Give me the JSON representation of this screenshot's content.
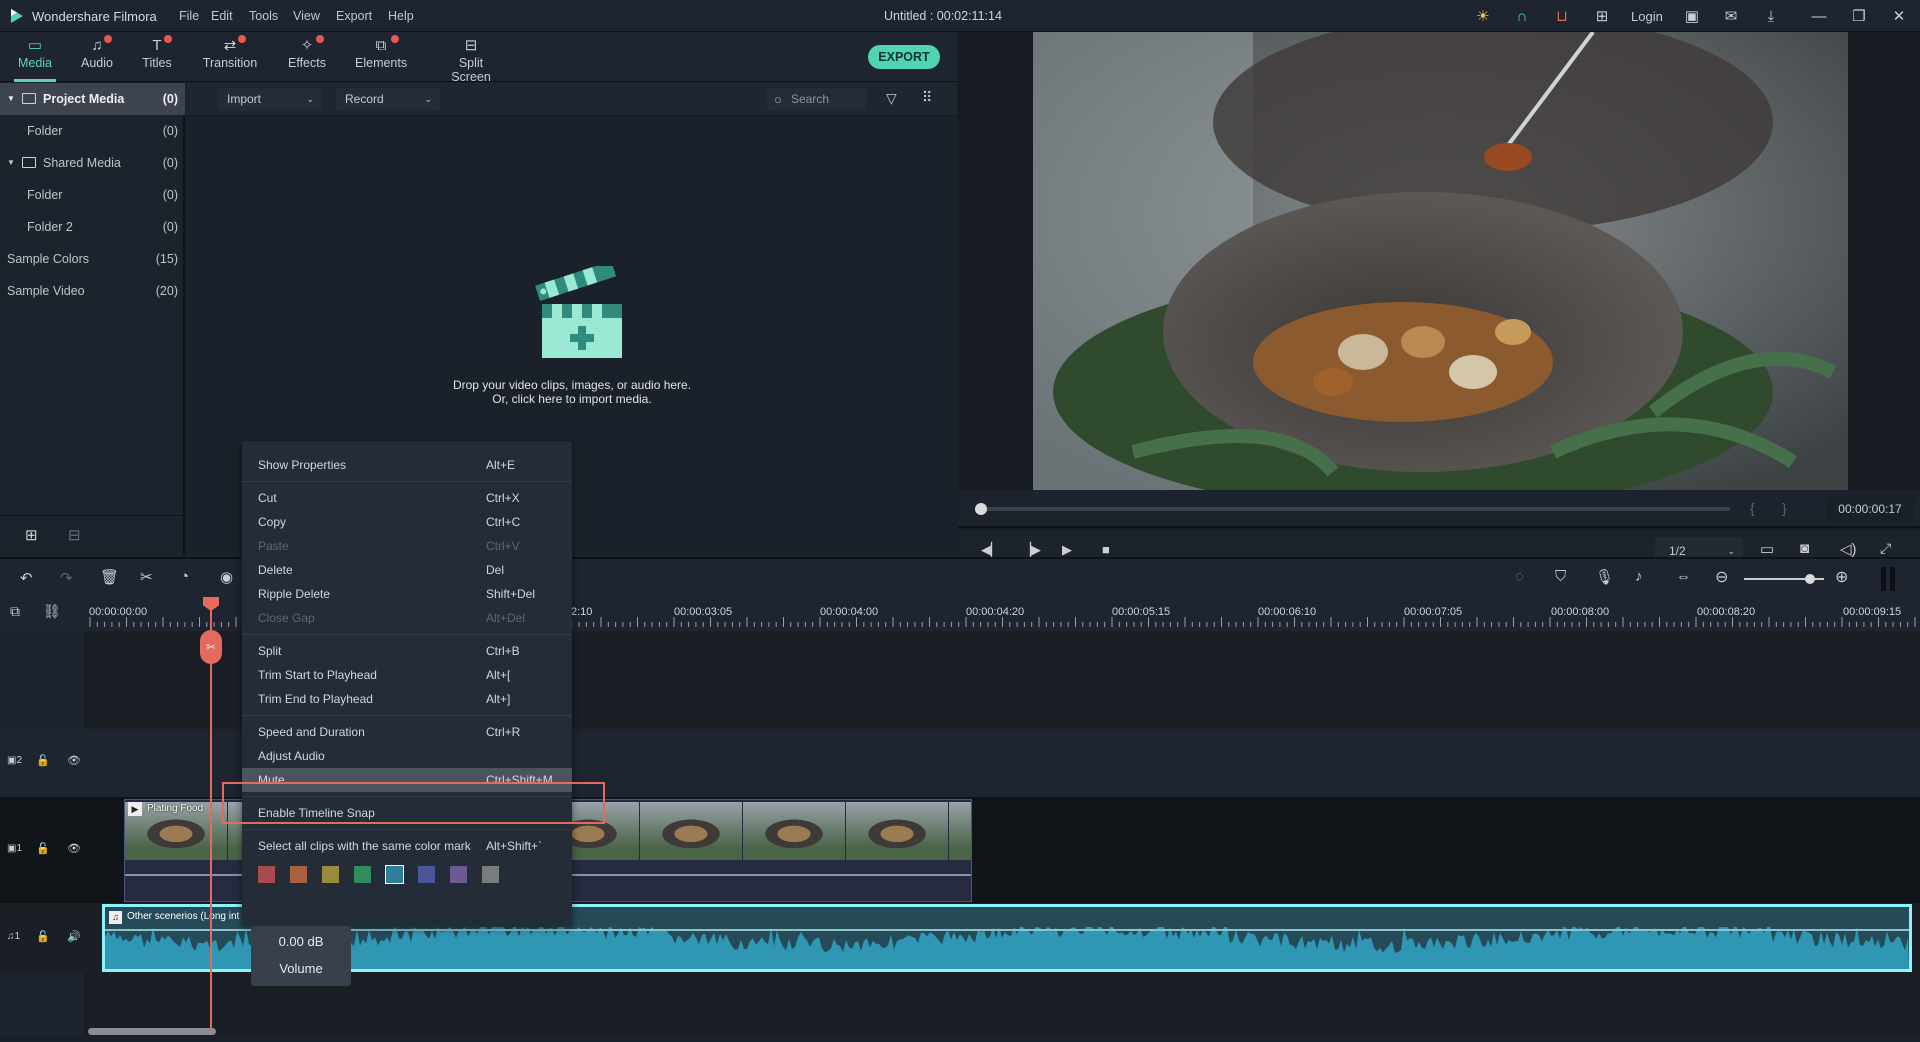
{
  "app": {
    "name": "Wondershare Filmora",
    "title": "Untitled : 00:02:11:14",
    "login_label": "Login"
  },
  "menu": [
    "File",
    "Edit",
    "Tools",
    "View",
    "Export",
    "Help"
  ],
  "tabs": [
    {
      "label": "Media",
      "icon": "folder-icon",
      "active": true,
      "dot": false
    },
    {
      "label": "Audio",
      "icon": "music-note-icon",
      "active": false,
      "dot": true
    },
    {
      "label": "Titles",
      "icon": "text-icon",
      "active": false,
      "dot": true
    },
    {
      "label": "Transition",
      "icon": "transition-icon",
      "active": false,
      "dot": true
    },
    {
      "label": "Effects",
      "icon": "effects-icon",
      "active": false,
      "dot": true
    },
    {
      "label": "Elements",
      "icon": "elements-icon",
      "active": false,
      "dot": true
    },
    {
      "label": "Split Screen",
      "icon": "split-screen-icon",
      "active": false,
      "dot": false
    }
  ],
  "export_label": "EXPORT",
  "sidebar": [
    {
      "label": "Project Media",
      "count": "(0)",
      "selected": true,
      "folder": true
    },
    {
      "label": "Folder",
      "count": "(0)",
      "indent": true
    },
    {
      "label": "Shared Media",
      "count": "(0)",
      "folder": true
    },
    {
      "label": "Folder",
      "count": "(0)",
      "indent": true
    },
    {
      "label": "Folder 2",
      "count": "(0)",
      "indent": true
    },
    {
      "label": "Sample Colors",
      "count": "(15)"
    },
    {
      "label": "Sample Video",
      "count": "(20)"
    }
  ],
  "media": {
    "import_label": "Import",
    "record_label": "Record",
    "search_placeholder": "Search",
    "empty_line1": "Drop your video clips, images, or audio here.",
    "empty_line2": "Or, click here to import media."
  },
  "preview": {
    "timecode": "00:00:00:17",
    "zoom": "1/2",
    "progress": 0.0
  },
  "timeline": {
    "ruler": [
      "00:00:00:00",
      "00:00:03:05",
      "00:00:04:00",
      "00:00:04:20",
      "00:00:05:15",
      "00:00:06:10",
      "00:00:07:05",
      "00:00:08:00",
      "00:00:08:20",
      "00:00:09:15"
    ],
    "ruler_partial": "2:10",
    "zoom_level": 0.82,
    "tracks": [
      {
        "id": "V2",
        "num": "2",
        "kind": "video"
      },
      {
        "id": "V1",
        "num": "1",
        "kind": "video"
      },
      {
        "id": "A1",
        "num": "1",
        "kind": "audio"
      }
    ],
    "video_clip": "Plating Food",
    "audio_clip": "Other scenerios  (Long int"
  },
  "context_menu": {
    "items": [
      {
        "label": "Show Properties",
        "key": "Alt+E"
      },
      {
        "sep": true
      },
      {
        "label": "Cut",
        "key": "Ctrl+X"
      },
      {
        "label": "Copy",
        "key": "Ctrl+C"
      },
      {
        "label": "Paste",
        "key": "Ctrl+V",
        "disabled": true
      },
      {
        "label": "Delete",
        "key": "Del"
      },
      {
        "label": "Ripple Delete",
        "key": "Shift+Del"
      },
      {
        "label": "Close Gap",
        "key": "Alt+Del",
        "disabled": true
      },
      {
        "sep": true
      },
      {
        "label": "Split",
        "key": "Ctrl+B"
      },
      {
        "label": "Trim Start to Playhead",
        "key": "Alt+["
      },
      {
        "label": "Trim End to Playhead",
        "key": "Alt+]"
      },
      {
        "sep": true
      },
      {
        "label": "Speed and Duration",
        "key": "Ctrl+R"
      },
      {
        "label": "Adjust Audio",
        "key": ""
      },
      {
        "label": "Mute",
        "key": "Ctrl+Shift+M",
        "highlighted": true
      },
      {
        "sep": true
      },
      {
        "label": "Enable Timeline Snap",
        "key": ""
      },
      {
        "sep": true
      },
      {
        "label": "Select all clips with the same color mark",
        "key": "Alt+Shift+`"
      }
    ],
    "color_marks": [
      "#a84b4b",
      "#a8613f",
      "#9c8a3c",
      "#2f8c5e",
      "#2e7f9c",
      "#4a5597",
      "#6c5a96",
      "#7a7b7d"
    ],
    "selected_color_index": 4
  },
  "volume_tooltip": {
    "value": "0.00 dB",
    "label": "Volume"
  }
}
